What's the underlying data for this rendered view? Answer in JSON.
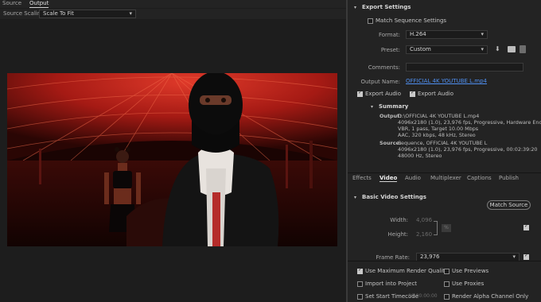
{
  "tabs": {
    "source": "Source",
    "output": "Output"
  },
  "source_scaling": {
    "label": "Source Scaling:",
    "value": "Scale To Fit"
  },
  "export_settings": {
    "title": "Export Settings",
    "match_sequence": {
      "label": "Match Sequence Settings",
      "checked": false
    },
    "format": {
      "label": "Format:",
      "value": "H.264"
    },
    "preset": {
      "label": "Preset:",
      "value": "Custom"
    },
    "comments": {
      "label": "Comments:",
      "value": ""
    },
    "output_name": {
      "label": "Output Name:",
      "value": "OFFICIAL 4K YOUTUBE L.mp4"
    },
    "export_video": {
      "label": "Export Audio",
      "checked": true
    },
    "export_audio": {
      "label": "Export Audio",
      "checked": true
    }
  },
  "summary": {
    "title": "Summary",
    "output_label": "Output:",
    "output_lines": [
      "D:\\OFFICIAL 4K YOUTUBE L.mp4",
      "4096x2180 (1.0), 23,976 fps, Progressive, Hardware Encodin...",
      "VBR, 1 pass, Target 10.00 Mbps",
      "AAC, 320 kbps, 48 kHz, Stereo"
    ],
    "source_label": "Source:",
    "source_lines": [
      "Sequence, OFFICIAL 4K YOUTUBE L",
      "4096x2180 (1.0), 23,976 fps, Progressive, 00:02:39:20",
      "48000 Hz, Stereo"
    ]
  },
  "settings_tabs": [
    "Effects",
    "Video",
    "Audio",
    "Multiplexer",
    "Captions",
    "Publish"
  ],
  "basic_video": {
    "title": "Basic Video Settings",
    "match_source": "Match Source",
    "width": {
      "label": "Width:",
      "value": "4,096"
    },
    "height": {
      "label": "Height:",
      "value": "2,160"
    },
    "link_label": "%",
    "frame_rate": {
      "label": "Frame Rate:",
      "value": "23,976"
    }
  },
  "bottom": {
    "use_max_render": {
      "label": "Use Maximum Render Quality",
      "checked": true
    },
    "use_previews": {
      "label": "Use Previews",
      "checked": false
    },
    "import_into_project": {
      "label": "Import into Project",
      "checked": false
    },
    "use_proxies": {
      "label": "Use Proxies",
      "checked": false
    },
    "set_start_timecode": {
      "label": "Set Start Timecode",
      "checked": false,
      "value": "00:00:00:00"
    },
    "render_alpha": {
      "label": "Render Alpha Channel Only",
      "checked": false
    }
  },
  "colors": {
    "bg": "#1e1e1e",
    "panel": "#232323",
    "link_blue": "#2d6fd1",
    "scene_red": "#c8231c"
  },
  "icons": [
    "save-preset-icon",
    "import-preset-icon",
    "delete-preset-icon",
    "chevron-down-icon",
    "chain-link-icon"
  ]
}
